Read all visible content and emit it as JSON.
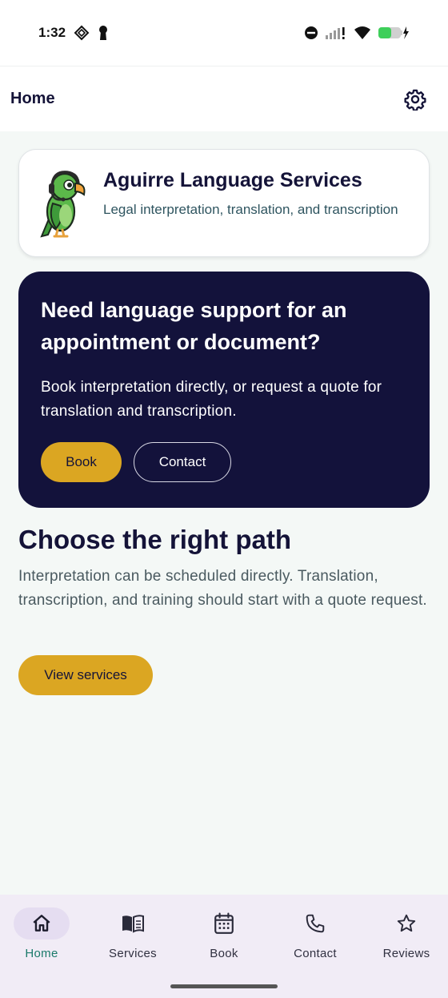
{
  "status_bar": {
    "time": "1:32",
    "icons": [
      "diamond-icon",
      "keyhole-icon",
      "do-not-disturb-icon",
      "signal-icon",
      "wifi-icon",
      "battery-charging-icon"
    ]
  },
  "app_bar": {
    "title": "Home",
    "settings_icon": "gear-icon"
  },
  "brand": {
    "name": "Aguirre Language Services",
    "tagline": "Legal interpretation, translation, and transcription",
    "logo": "parrot-with-headset"
  },
  "hero": {
    "title": "Need language support for an appointment or document?",
    "body": "Book interpretation directly, or request a quote for translation and transcription.",
    "book_label": "Book",
    "contact_label": "Contact"
  },
  "section": {
    "title": "Choose the right path",
    "body": "Interpretation can be scheduled directly. Translation, transcription, and training should start with a quote request.",
    "cta_label": "View services"
  },
  "bottom_nav": {
    "items": [
      {
        "label": "Home",
        "icon": "home-icon",
        "active": true
      },
      {
        "label": "Services",
        "icon": "book-open-icon",
        "active": false
      },
      {
        "label": "Book",
        "icon": "calendar-icon",
        "active": false
      },
      {
        "label": "Contact",
        "icon": "phone-icon",
        "active": false
      },
      {
        "label": "Reviews",
        "icon": "star-icon",
        "active": false
      }
    ]
  },
  "colors": {
    "navy": "#13123b",
    "gold": "#dba622",
    "active_teal": "#1a7a6a",
    "nav_bg": "#f1ecf6",
    "page_bg": "#f4f8f6"
  }
}
